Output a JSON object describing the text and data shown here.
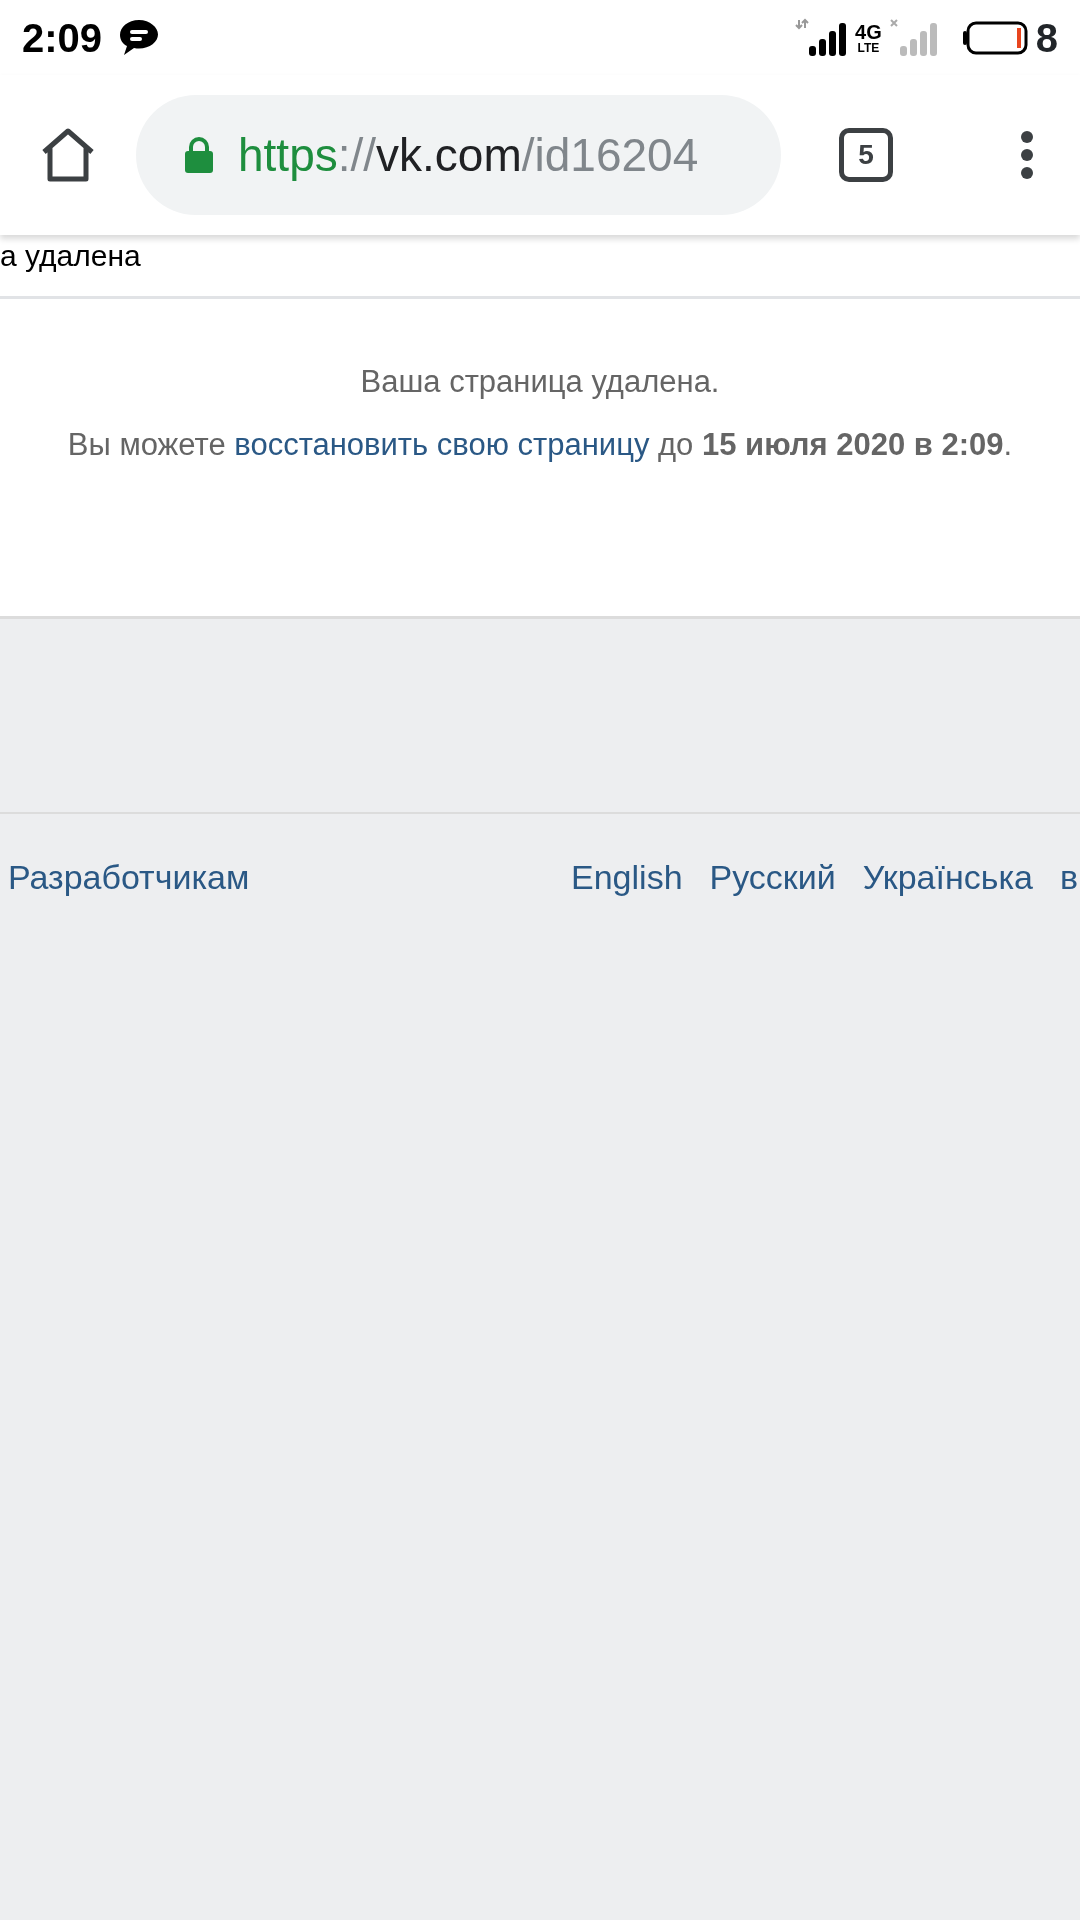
{
  "status_bar": {
    "time": "2:09",
    "network_type": "4G",
    "network_sub": "LTE",
    "battery_text": "8"
  },
  "browser_toolbar": {
    "url": {
      "scheme": "https",
      "separator": "://",
      "host": "vk.com",
      "path": "/id16204"
    },
    "tab_count": "5"
  },
  "page": {
    "header_fragment": "а удалена",
    "message": {
      "title": "Ваша страница удалена.",
      "before": "Вы можете",
      "link": "восстановить свою страницу",
      "after": "до **15 июля 2020 в 2:09**."
    },
    "footer": {
      "left_links": [
        "Разработчикам"
      ],
      "languages": [
        "English",
        "Русский",
        "Українська",
        "в"
      ]
    }
  }
}
